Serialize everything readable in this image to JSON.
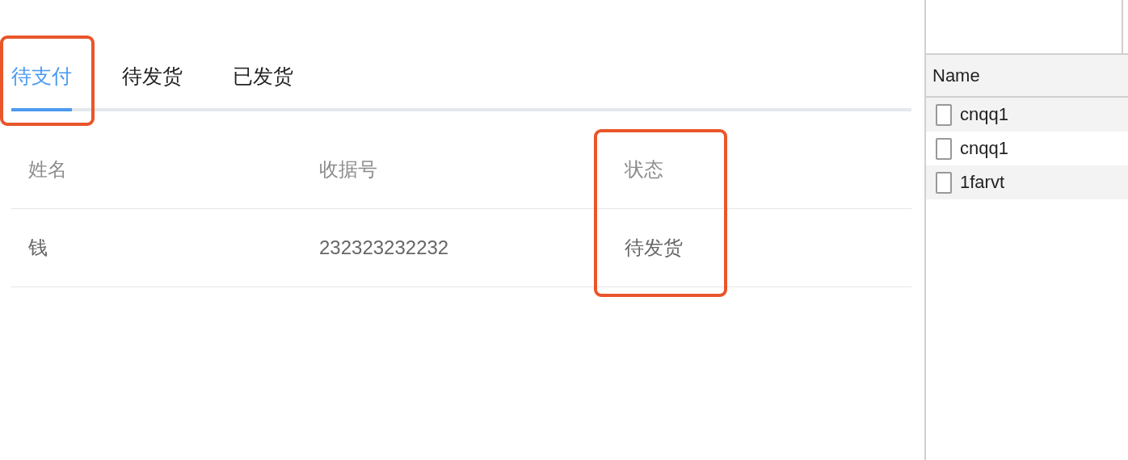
{
  "tabs": [
    {
      "label": "待支付",
      "selected": true,
      "highlighted": true
    },
    {
      "label": "待发货",
      "selected": false,
      "highlighted": false
    },
    {
      "label": "已发货",
      "selected": false,
      "highlighted": false
    }
  ],
  "table": {
    "columns": [
      {
        "label": "姓名",
        "highlighted": false
      },
      {
        "label": "收据号",
        "highlighted": false
      },
      {
        "label": "状态",
        "highlighted": true
      }
    ],
    "rows": [
      [
        "钱",
        "232323232232",
        "待发货"
      ]
    ]
  },
  "network_panel": {
    "header": "Name",
    "rows": [
      "cnqq1",
      "cnqq1",
      "1farvt"
    ]
  }
}
